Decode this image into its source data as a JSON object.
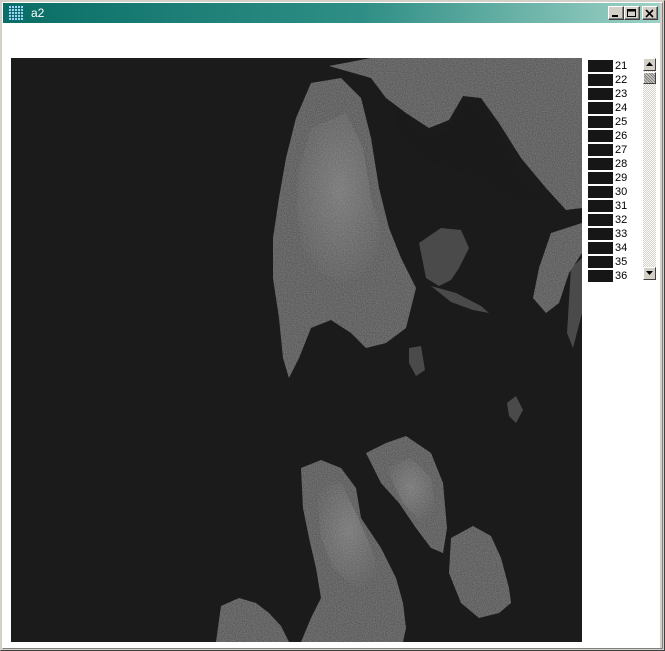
{
  "window": {
    "title": "a2",
    "minimize_icon": "minimize-icon",
    "maximize_icon": "maximize-icon",
    "close_icon": "close-icon"
  },
  "image": {
    "kind": "grayscale-satellite-image",
    "background_color": "#1b1b1b"
  },
  "legend": {
    "swatch_color": "#161616",
    "items": [
      "21",
      "22",
      "23",
      "24",
      "25",
      "26",
      "27",
      "28",
      "29",
      "30",
      "31",
      "32",
      "33",
      "34",
      "35",
      "36"
    ]
  },
  "scrollbar": {
    "up_icon": "arrow-up-icon",
    "down_icon": "arrow-down-icon"
  }
}
